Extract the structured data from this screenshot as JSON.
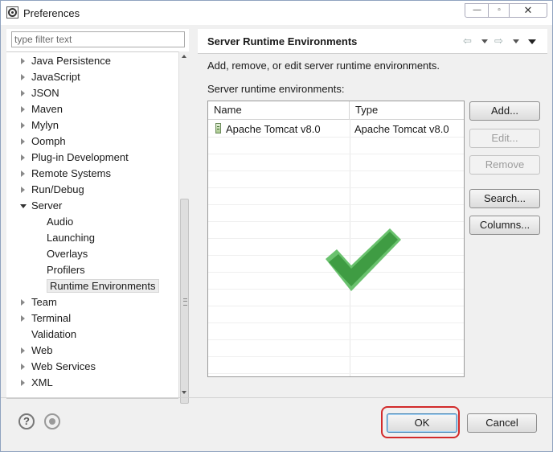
{
  "window": {
    "title": "Preferences",
    "app_icon": "eclipse-gear-icon",
    "controls": {
      "minimize": "—",
      "maximize": "▫",
      "close": "✕"
    }
  },
  "filter": {
    "placeholder": "type filter text"
  },
  "tree": {
    "items": [
      {
        "label": "Java Persistence",
        "expandable": true,
        "expanded": false,
        "level": 0
      },
      {
        "label": "JavaScript",
        "expandable": true,
        "expanded": false,
        "level": 0
      },
      {
        "label": "JSON",
        "expandable": true,
        "expanded": false,
        "level": 0
      },
      {
        "label": "Maven",
        "expandable": true,
        "expanded": false,
        "level": 0
      },
      {
        "label": "Mylyn",
        "expandable": true,
        "expanded": false,
        "level": 0
      },
      {
        "label": "Oomph",
        "expandable": true,
        "expanded": false,
        "level": 0
      },
      {
        "label": "Plug-in Development",
        "expandable": true,
        "expanded": false,
        "level": 0
      },
      {
        "label": "Remote Systems",
        "expandable": true,
        "expanded": false,
        "level": 0
      },
      {
        "label": "Run/Debug",
        "expandable": true,
        "expanded": false,
        "level": 0
      },
      {
        "label": "Server",
        "expandable": true,
        "expanded": true,
        "level": 0
      },
      {
        "label": "Audio",
        "expandable": false,
        "level": 1
      },
      {
        "label": "Launching",
        "expandable": false,
        "level": 1
      },
      {
        "label": "Overlays",
        "expandable": false,
        "level": 1
      },
      {
        "label": "Profilers",
        "expandable": false,
        "level": 1
      },
      {
        "label": "Runtime Environments",
        "expandable": false,
        "level": 1,
        "selected": true
      },
      {
        "label": "Team",
        "expandable": true,
        "expanded": false,
        "level": 0
      },
      {
        "label": "Terminal",
        "expandable": true,
        "expanded": false,
        "level": 0
      },
      {
        "label": "Validation",
        "expandable": false,
        "level": 0
      },
      {
        "label": "Web",
        "expandable": true,
        "expanded": false,
        "level": 0
      },
      {
        "label": "Web Services",
        "expandable": true,
        "expanded": false,
        "level": 0
      },
      {
        "label": "XML",
        "expandable": true,
        "expanded": false,
        "level": 0
      }
    ]
  },
  "page": {
    "title": "Server Runtime Environments",
    "description": "Add, remove, or edit server runtime environments.",
    "list_label": "Server runtime environments:",
    "nav": {
      "back_icon": "⇦",
      "forward_icon": "⇨"
    }
  },
  "table": {
    "columns": [
      "Name",
      "Type"
    ],
    "rows": [
      {
        "name": "Apache Tomcat v8.0",
        "type": "Apache Tomcat v8.0",
        "icon": "server-runtime-icon"
      }
    ]
  },
  "buttons": {
    "add": "Add...",
    "edit": "Edit...",
    "remove": "Remove",
    "search": "Search...",
    "columns": "Columns...",
    "ok": "OK",
    "cancel": "Cancel",
    "help": "?"
  },
  "colors": {
    "checkmark": "#4caf50",
    "highlight_box": "#d22b2b",
    "default_button_border": "#3c7fb1"
  }
}
